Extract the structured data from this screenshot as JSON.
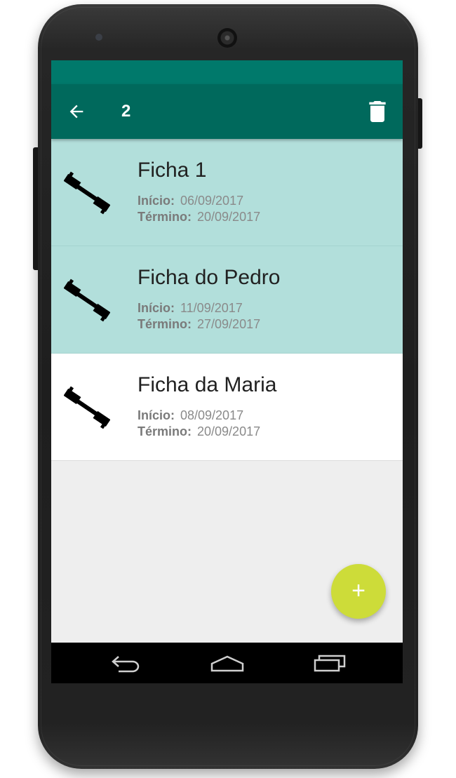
{
  "app_bar": {
    "selected_count": "2",
    "back_icon": "arrow-back-icon",
    "delete_icon": "trash-icon"
  },
  "colors": {
    "status_bar": "#00796b",
    "app_bar": "#00695c",
    "selected_row": "#b2dfdb",
    "fab": "#cddc39"
  },
  "fichas": [
    {
      "title": "Ficha 1",
      "start_label": "Início:",
      "start_date": "06/09/2017",
      "end_label": "Término:",
      "end_date": "20/09/2017",
      "selected": true,
      "icon": "dumbbell-icon"
    },
    {
      "title": "Ficha do Pedro",
      "start_label": "Início:",
      "start_date": "11/09/2017",
      "end_label": "Término:",
      "end_date": "27/09/2017",
      "selected": true,
      "icon": "dumbbell-icon"
    },
    {
      "title": "Ficha da Maria",
      "start_label": "Início:",
      "start_date": "08/09/2017",
      "end_label": "Término:",
      "end_date": "20/09/2017",
      "selected": false,
      "icon": "dumbbell-icon"
    }
  ],
  "fab": {
    "label": "+",
    "icon": "plus-icon"
  },
  "nav_bar": {
    "back_icon": "nav-back-icon",
    "home_icon": "nav-home-icon",
    "recents_icon": "nav-recents-icon"
  }
}
